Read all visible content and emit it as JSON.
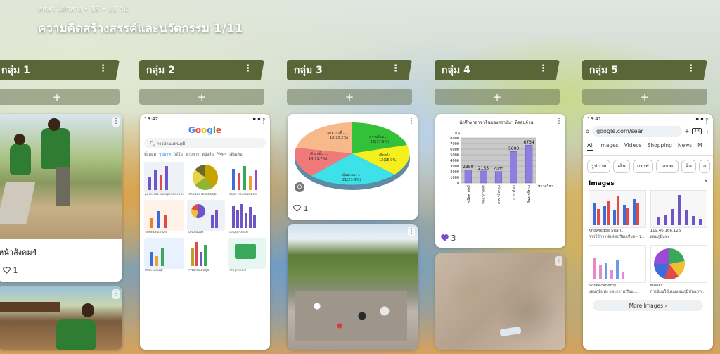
{
  "header": {
    "meta": "สลิษา ปิ่ยกลาง • 18 • 13 วัน",
    "title": "ความคิดสร้างสรรค์และนวัตกรรม 1/11"
  },
  "columns": [
    {
      "title": "กลุ่ม 1"
    },
    {
      "title": "กลุ่ม 2"
    },
    {
      "title": "กลุ่ม 3"
    },
    {
      "title": "กลุ่ม 4"
    },
    {
      "title": "กลุ่ม 5"
    }
  ],
  "ui": {
    "add_symbol": "+",
    "kebab": "⋮"
  },
  "cards": {
    "g1_post1": {
      "caption": "หน้าสังคม4",
      "likes": "1"
    },
    "g3_post1": {
      "likes": "1"
    },
    "g4_post1": {
      "likes": "3"
    }
  },
  "pie": {
    "labels": [
      "บุคลากรที่ ...",
      "ความร้อน ...",
      "เสียงดัง ...",
      "กลิ่นเหม็น ...",
      "ฝุ่นละออง ..."
    ],
    "values": [
      "18(20.2%)",
      "16(17.9%)",
      "13(15.9%)",
      "14(11.7%)",
      "21(23.4%)"
    ]
  },
  "g4_chart": {
    "title": "นักศึกษาสาขาจีนของสถาบันฯ ที่สอนจ้าน",
    "bar_labels": [
      "2350",
      "2135",
      "2035",
      "5600",
      "6734"
    ],
    "ytick_labels": [
      "8000",
      "7000",
      "6000",
      "5000",
      "4000",
      "3000",
      "2000",
      "1000",
      "0"
    ],
    "categories": [
      "คณิตศาสตร์",
      "วิทยาศาสตร์",
      "ภาษาอังกฤษ",
      "ภาษาไทย",
      "พัฒนาสังคม"
    ],
    "legend": "หมวดวิชา",
    "y_unit": "คน"
  },
  "chart_data": {
    "type": "bar",
    "title": "นักศึกษาสาขาจีนของสถาบันฯ ที่สอนจ้าน",
    "categories": [
      "คณิตศาสตร์",
      "วิทยาศาสตร์",
      "ภาษาอังกฤษ",
      "ภาษาไทย",
      "พัฒนาสังคม"
    ],
    "values": [
      2350,
      2135,
      2035,
      5600,
      6734
    ],
    "ylim": [
      0,
      8000
    ],
    "ylabel": "คน"
  },
  "g2_screenshot": {
    "status": "13:42",
    "logo": "Google",
    "query": "การอ่านแผนภูมิ",
    "tabs": [
      "ทั้งหมด",
      "รูปภาพ",
      "วิดีโอ",
      "ข่าวสาร",
      "หนังสือ",
      "Maps",
      "เพิ่มเติม"
    ],
    "captions": [
      "pareerat.wordpress.com",
      "พรีเมียมสไตล์แผนภูมิ",
      "Data visualization",
      "ฉบับพิมพ์แผนภูมิ",
      "แผนภูมิแท่ง",
      "แผนภูมิวงกลม",
      "ทักษะแผนภูมิ",
      "การอ่านแผนภูมิ",
      "Infographic"
    ]
  },
  "g5_screenshot": {
    "status": "13:41",
    "url": "google.com/sear",
    "tab_count": "13",
    "tabs": [
      "All",
      "Images",
      "Videos",
      "Shopping",
      "News",
      "M"
    ],
    "chips": [
      "รูปภาพ",
      "เส้น",
      "กราฟ",
      "วงกลม",
      "ศิล",
      "ก"
    ],
    "images_title": "Images",
    "results": [
      {
        "source": "Knowledge Shari...",
        "caption": "การใช้กราฟแท่งเปรียบเทียบ - ร..."
      },
      {
        "source": "119.46.166.126",
        "caption": "แผนภูมิแท่ง"
      },
      {
        "source": "NockAcademy",
        "caption": "แผนภูมิแท่ง และการเปรียบเ..."
      },
      {
        "source": "iBooks",
        "caption": "การนิยมใช้แบบแผนภูมิประเภท..."
      }
    ],
    "more_images": "More Images  ›"
  }
}
